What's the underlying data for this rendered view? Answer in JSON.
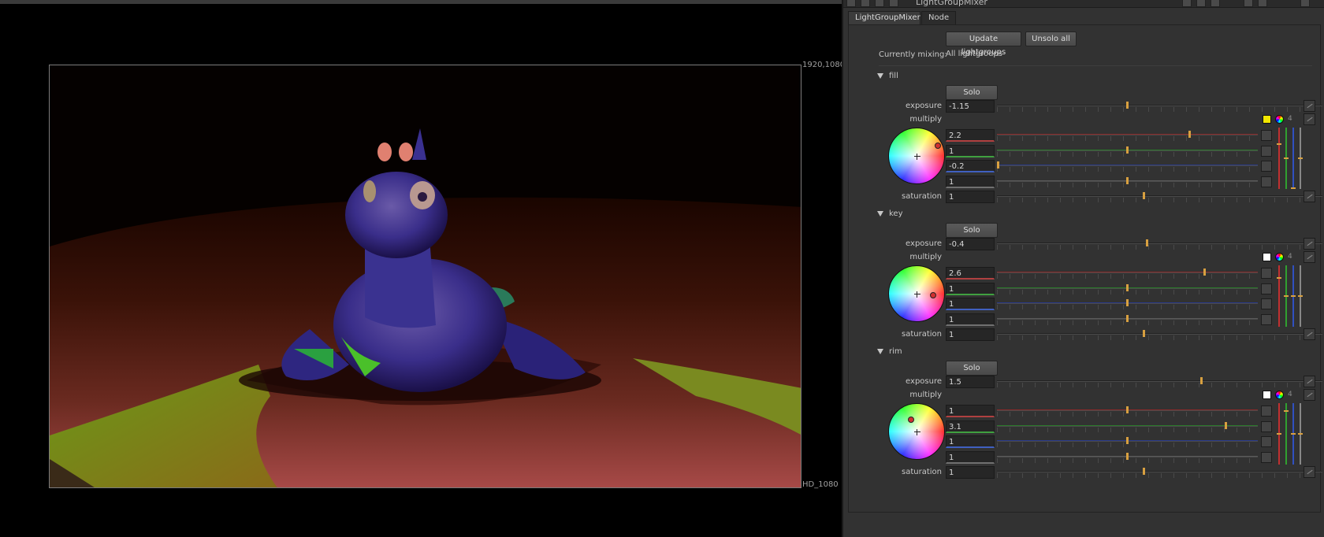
{
  "viewer": {
    "resolution_label": "1920,1080",
    "format_label": "HD_1080"
  },
  "panel": {
    "title": "LightGroupMixer",
    "tabs": [
      "LightGroupMixer",
      "Node"
    ],
    "update_button": "Update lightgroups",
    "unsolo_button": "Unsolo all",
    "mixing_label": "Currently mixing:",
    "mixing_value": "All lightgroups",
    "labels": {
      "solo": "Solo",
      "exposure": "exposure",
      "multiply": "multiply",
      "saturation": "saturation",
      "channel_count": "4"
    },
    "exposure_ticks": [
      "-5.7",
      "-5",
      "-4",
      "-3",
      "-2",
      "-1",
      "0",
      "1",
      "2",
      "3",
      "4",
      "5",
      "5.7"
    ],
    "multiply_ticks": [
      "0",
      "0.1",
      "0.2",
      "0.4",
      "0.6",
      "0.8",
      "1",
      "2",
      "3"
    ],
    "groups": [
      {
        "name": "fill",
        "exposure": "-1.15",
        "exposure_level": 0.4,
        "multiply": [
          "2.2",
          "1",
          "-0.2",
          "1"
        ],
        "multiply_levels": [
          0.74,
          0.5,
          0.0,
          0.5
        ],
        "saturation": "1",
        "swatch_color": "#f2e600"
      },
      {
        "name": "key",
        "exposure": "-0.4",
        "exposure_level": 0.46,
        "multiply": [
          "2.6",
          "1",
          "1",
          "1"
        ],
        "multiply_levels": [
          0.8,
          0.5,
          0.5,
          0.5
        ],
        "saturation": "1",
        "swatch_color": "#ffffff"
      },
      {
        "name": "rim",
        "exposure": "1.5",
        "exposure_level": 0.63,
        "multiply": [
          "1",
          "3.1",
          "1",
          "1"
        ],
        "multiply_levels": [
          0.5,
          0.88,
          0.5,
          0.5
        ],
        "saturation": "1",
        "swatch_color": "#ffffff"
      }
    ]
  }
}
